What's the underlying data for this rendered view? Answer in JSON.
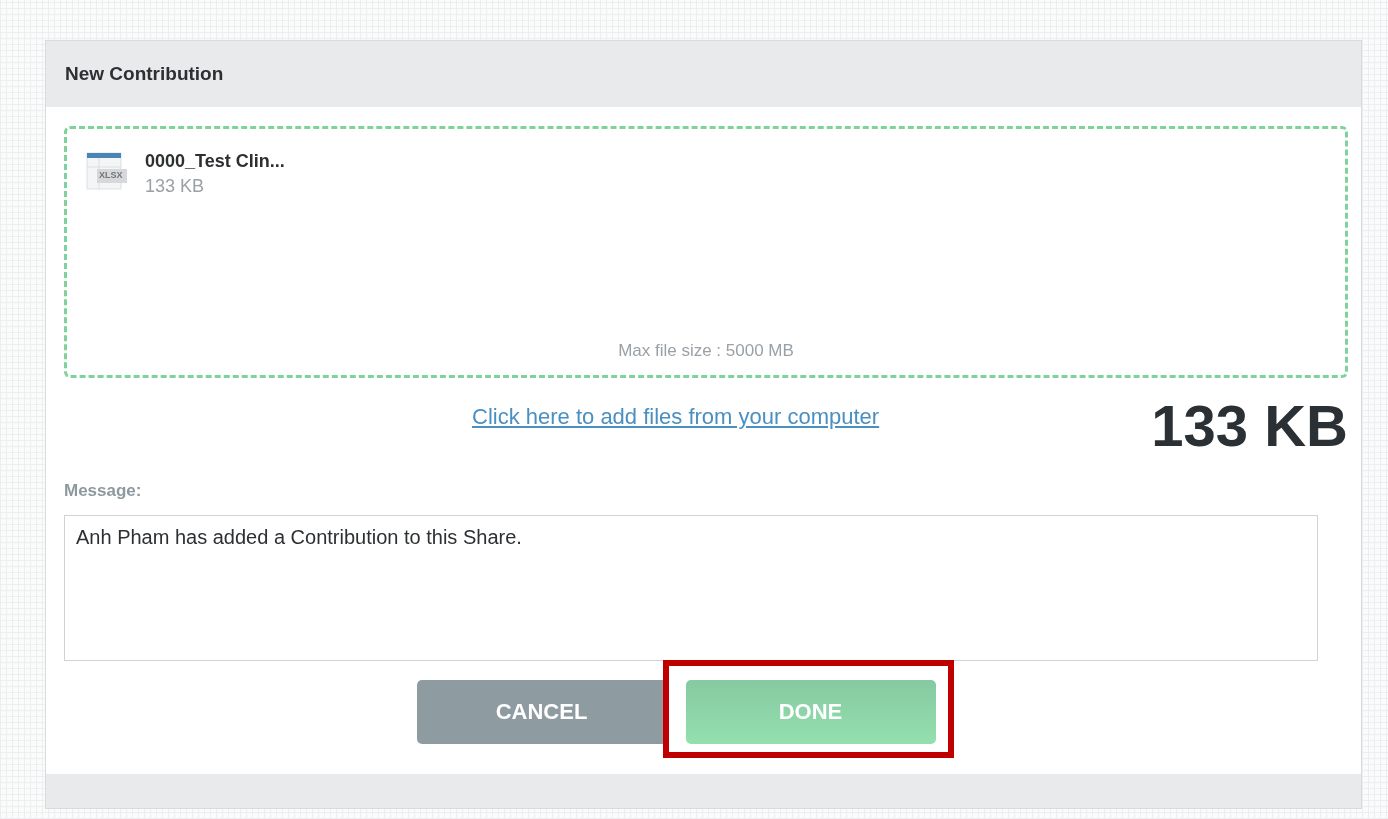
{
  "dialog": {
    "title": "New Contribution"
  },
  "dropzone": {
    "files": [
      {
        "name": "0000_Test Clin...",
        "type": "XLSX",
        "size": "133 KB"
      }
    ],
    "hint": "Max file size : 5000 MB"
  },
  "add_files_link": "Click here to add files from your computer",
  "total_size": "133 KB",
  "message": {
    "label": "Message:",
    "value": "Anh Pham has added a Contribution to this Share."
  },
  "buttons": [
    {
      "label": "CANCEL",
      "kind": "secondary",
      "highlighted": false
    },
    {
      "label": "DONE",
      "kind": "primary",
      "highlighted": true
    }
  ]
}
